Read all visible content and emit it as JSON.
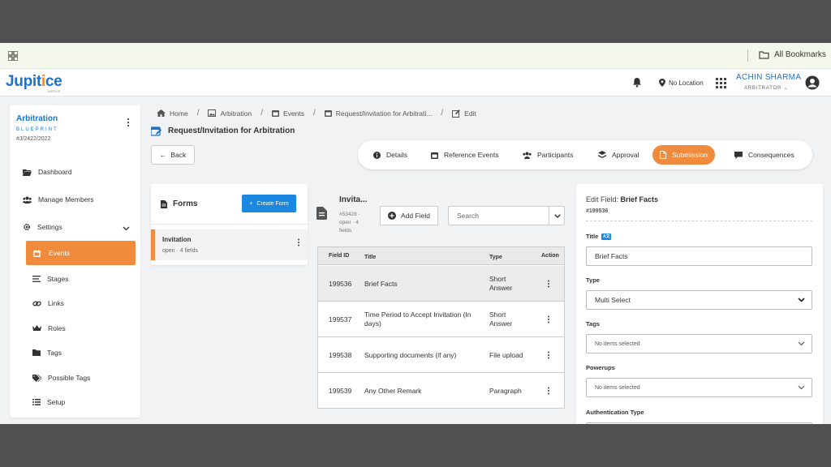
{
  "bookmarks": {
    "all_label": "All Bookmarks"
  },
  "app": {
    "logo": "Jupitice",
    "logo_sub": "JUSTICE",
    "location": "No Location",
    "user_name": "ACHIN SHARMA",
    "user_role": "ARBITRATOR"
  },
  "sidebar": {
    "title": "Arbitration",
    "subtitle": "BLUEPRINT",
    "id": "#J/2422/2022",
    "items": [
      {
        "label": "Dashboard",
        "icon": "folder-open-icon"
      },
      {
        "label": "Manage Members",
        "icon": "users-icon"
      },
      {
        "label": "Settings",
        "icon": "gear-icon"
      }
    ],
    "sub_items": [
      {
        "label": "Events",
        "icon": "calendar-icon"
      },
      {
        "label": "Stages",
        "icon": "bars-icon"
      },
      {
        "label": "Links",
        "icon": "link-icon"
      },
      {
        "label": "Roles",
        "icon": "crown-icon"
      },
      {
        "label": "Tags",
        "icon": "folder-icon"
      },
      {
        "label": "Possible Tags",
        "icon": "tags-icon"
      },
      {
        "label": "Setup",
        "icon": "list-icon"
      }
    ]
  },
  "breadcrumb": [
    {
      "label": "Home"
    },
    {
      "label": "Arbitration"
    },
    {
      "label": "Events"
    },
    {
      "label": "Request/Invitation for Arbitrati..."
    },
    {
      "label": "Edit"
    }
  ],
  "page": {
    "title": "Request/Invitation for Arbitration",
    "back_label": "Back"
  },
  "tabs": [
    {
      "label": "Details"
    },
    {
      "label": "Reference Events"
    },
    {
      "label": "Participants"
    },
    {
      "label": "Approval"
    },
    {
      "label": "Submission"
    },
    {
      "label": "Consequences"
    }
  ],
  "forms": {
    "heading": "Forms",
    "create_label": "Create Form",
    "items": [
      {
        "title": "Invitation",
        "meta": "open · 4 fields"
      }
    ]
  },
  "form_detail": {
    "title": "Invita...",
    "meta_id": "#53428 ·",
    "meta_status": "open · 4",
    "meta_fields": "fields",
    "add_field_label": "Add Field",
    "search_placeholder": "Search"
  },
  "table": {
    "headers": {
      "id": "Field ID",
      "title": "Title",
      "type": "Type",
      "action": "Action"
    },
    "rows": [
      {
        "id": "199536",
        "title": "Brief Facts",
        "type": "Short Answer"
      },
      {
        "id": "199537",
        "title": "Time Period to Accept Invitation (In days)",
        "type": "Short Answer"
      },
      {
        "id": "199538",
        "title": "Supporting documents (if any)",
        "type": "File upload"
      },
      {
        "id": "199539",
        "title": "Any Other Remark",
        "type": "Paragraph"
      }
    ]
  },
  "edit_field": {
    "heading_prefix": "Edit Field:",
    "heading_name": "Brief Facts",
    "id": "#199536",
    "title_label": "Title",
    "title_value": "Brief Facts",
    "type_label": "Type",
    "type_value": "Multi Select",
    "tags_label": "Tags",
    "tags_value": "No items selected",
    "powerups_label": "Powerups",
    "powerups_value": "No items selected",
    "auth_label": "Authentication Type"
  },
  "colors": {
    "brand_blue": "#1c72c8",
    "accent_orange": "#f08a3c",
    "button_blue": "#1c87e0"
  }
}
